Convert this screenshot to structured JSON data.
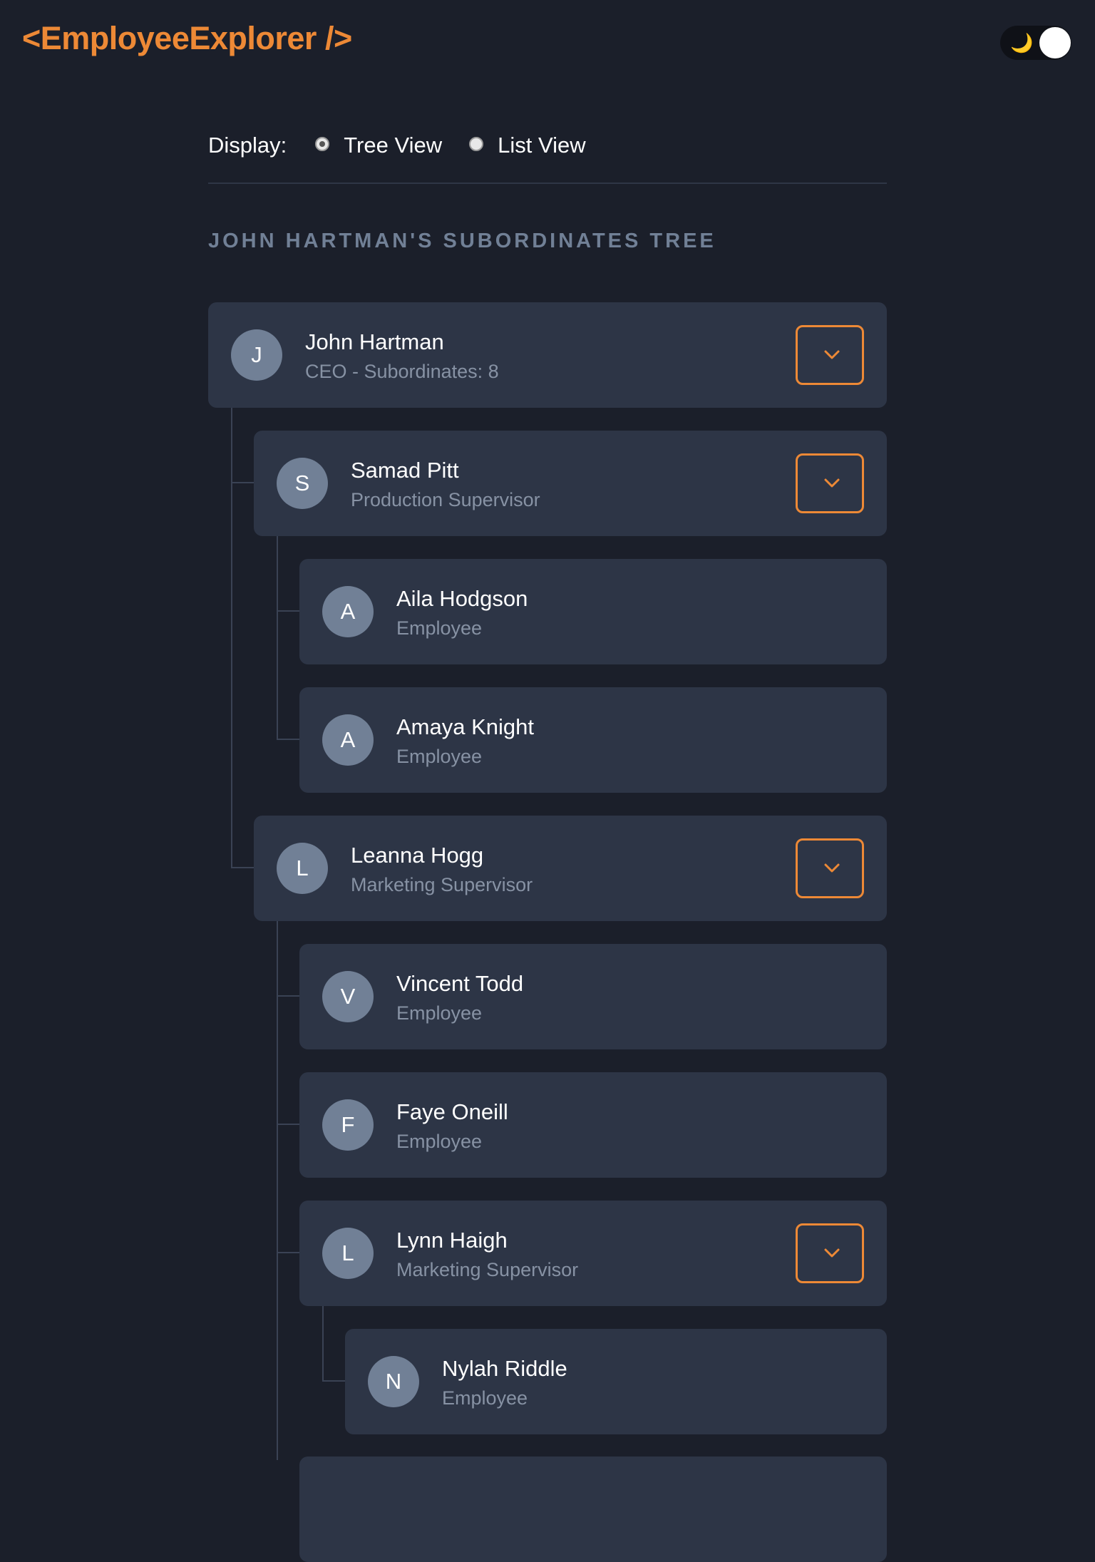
{
  "app": {
    "logo": "<EmployeeExplorer />",
    "theme_icon": "moon-icon"
  },
  "display": {
    "label": "Display:",
    "options": [
      {
        "label": "Tree View",
        "checked": true
      },
      {
        "label": "List View",
        "checked": false
      }
    ]
  },
  "tree": {
    "title": "JOHN HARTMAN'S SUBORDINATES TREE",
    "nodes": [
      {
        "initial": "J",
        "name": "John Hartman",
        "role": "CEO - Subordinates: 8",
        "expandable": true,
        "level": 0
      },
      {
        "initial": "S",
        "name": "Samad Pitt",
        "role": "Production Supervisor",
        "expandable": true,
        "level": 1
      },
      {
        "initial": "A",
        "name": "Aila Hodgson",
        "role": "Employee",
        "expandable": false,
        "level": 2
      },
      {
        "initial": "A",
        "name": "Amaya Knight",
        "role": "Employee",
        "expandable": false,
        "level": 2
      },
      {
        "initial": "L",
        "name": "Leanna Hogg",
        "role": "Marketing Supervisor",
        "expandable": true,
        "level": 1
      },
      {
        "initial": "V",
        "name": "Vincent Todd",
        "role": "Employee",
        "expandable": false,
        "level": 2
      },
      {
        "initial": "F",
        "name": "Faye Oneill",
        "role": "Employee",
        "expandable": false,
        "level": 2
      },
      {
        "initial": "L",
        "name": "Lynn Haigh",
        "role": "Marketing Supervisor",
        "expandable": true,
        "level": 2
      },
      {
        "initial": "N",
        "name": "Nylah Riddle",
        "role": "Employee",
        "expandable": false,
        "level": 3
      }
    ]
  },
  "colors": {
    "accent": "#ed8936",
    "background": "#1b1f2a",
    "card": "#2d3546",
    "avatar": "#718096"
  }
}
